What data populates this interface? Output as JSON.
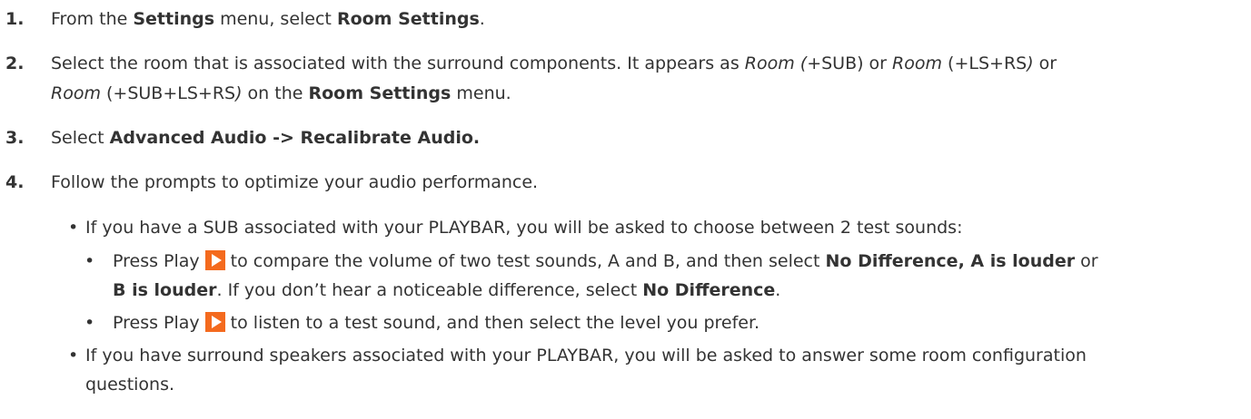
{
  "steps": [
    {
      "number": "1.",
      "s1": "From the ",
      "s2": "Settings",
      "s3": " menu, select ",
      "s4": "Room Settings",
      "s5": "."
    },
    {
      "number": "2.",
      "s1": "Select the room that is associated with the surround components. It appears as ",
      "s2": "Room (",
      "s3": "+SUB) or ",
      "s4": "Room",
      "s5": " (+LS+RS",
      "s6": ")",
      "s7": " or",
      "s8": "Room",
      "s9": " (+SUB+LS+RS",
      "s10": ")",
      "s11": " on the ",
      "s12": "Room Settings",
      "s13": " menu."
    },
    {
      "number": "3.",
      "s1": "Select ",
      "s2": "Advanced Audio -> Recalibrate Audio."
    },
    {
      "number": "4.",
      "s1": "Follow the prompts to optimize your audio performance."
    }
  ],
  "bullets": {
    "sub": "If you have a SUB associated with your PLAYBAR, you will be asked to choose between 2 test sounds:",
    "press1": {
      "a": "Press Play",
      "b": "to compare the volume of two test sounds, A and B, and then select ",
      "c": "No Difference",
      "d": ", ",
      "e": "A is louder",
      "f": " or",
      "g": "B is louder",
      "h": ". If you don’t hear a noticeable difference, select ",
      "i": "No Difference",
      "j": "."
    },
    "press2": {
      "a": "Press Play",
      "b": "to listen to a test sound, and then select the level you prefer."
    },
    "surround": {
      "line1": "If you have surround speakers associated with your PLAYBAR, you will be asked to answer some room configuration",
      "line2": "questions."
    }
  },
  "bullet_glyph": "•",
  "icons": {
    "play": "play-icon"
  },
  "colors": {
    "text": "#333333",
    "play_accent": "#f46a1e"
  }
}
